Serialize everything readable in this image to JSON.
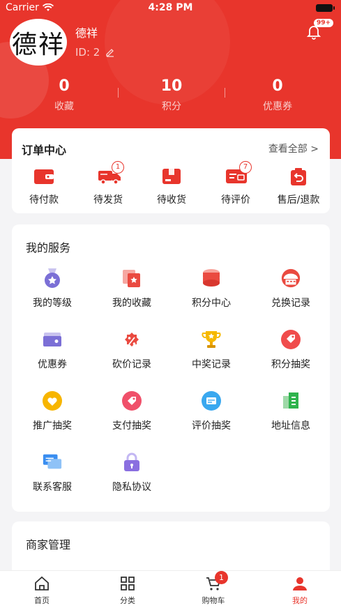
{
  "status_bar": {
    "carrier": "Carrier",
    "time": "4:28 PM"
  },
  "profile": {
    "avatar_text": "德祥",
    "name": "德祥",
    "id_text": "ID: 2",
    "notification_badge": "99+"
  },
  "stats": [
    {
      "value": "0",
      "label": "收藏"
    },
    {
      "value": "10",
      "label": "积分"
    },
    {
      "value": "0",
      "label": "优惠券"
    }
  ],
  "orders": {
    "title": "订单中心",
    "view_all": "查看全部 >",
    "items": [
      {
        "label": "待付款",
        "icon": "wallet-icon",
        "badge": ""
      },
      {
        "label": "待发货",
        "icon": "truck-icon",
        "badge": "1"
      },
      {
        "label": "待收货",
        "icon": "package-icon",
        "badge": ""
      },
      {
        "label": "待评价",
        "icon": "review-icon",
        "badge": "7"
      },
      {
        "label": "售后/退款",
        "icon": "refund-icon",
        "badge": ""
      }
    ]
  },
  "services": {
    "title": "我的服务",
    "items": [
      {
        "label": "我的等级",
        "icon": "medal-icon"
      },
      {
        "label": "我的收藏",
        "icon": "favorite-icon"
      },
      {
        "label": "积分中心",
        "icon": "coins-icon"
      },
      {
        "label": "兑换记录",
        "icon": "exchange-icon"
      },
      {
        "label": "优惠券",
        "icon": "coupon-icon"
      },
      {
        "label": "砍价记录",
        "icon": "discount-icon"
      },
      {
        "label": "中奖记录",
        "icon": "trophy-icon"
      },
      {
        "label": "积分抽奖",
        "icon": "points-lottery-icon"
      },
      {
        "label": "推广抽奖",
        "icon": "heart-icon"
      },
      {
        "label": "支付抽奖",
        "icon": "tag-icon"
      },
      {
        "label": "评价抽奖",
        "icon": "card-icon"
      },
      {
        "label": "地址信息",
        "icon": "address-icon"
      },
      {
        "label": "联系客服",
        "icon": "chat-icon"
      },
      {
        "label": "隐私协议",
        "icon": "lock-icon"
      }
    ]
  },
  "merchant": {
    "title": "商家管理"
  },
  "tabbar": {
    "items": [
      {
        "label": "首页",
        "icon": "home-icon"
      },
      {
        "label": "分类",
        "icon": "grid-icon"
      },
      {
        "label": "购物车",
        "icon": "cart-icon",
        "badge": "1"
      },
      {
        "label": "我的",
        "icon": "user-icon"
      }
    ]
  },
  "colors": {
    "brand": "#e8352c",
    "background": "#f4f4f6"
  }
}
